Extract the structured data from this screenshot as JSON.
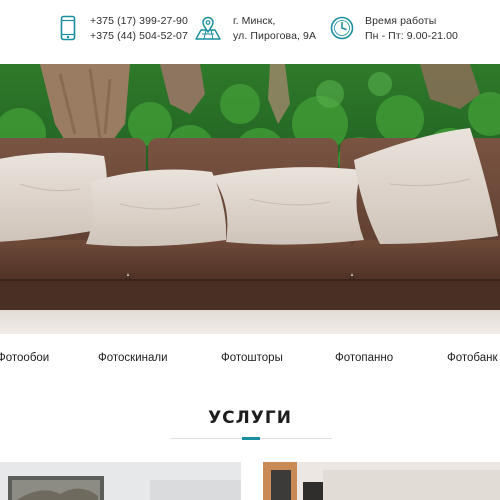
{
  "contacts": {
    "phone": {
      "icon": "phone-icon",
      "line1": "+375 (17) 399-27-90",
      "line2": "+375 (44) 504-52-07"
    },
    "address": {
      "icon": "map-pin-icon",
      "line1": "г. Минск,",
      "line2": "ул. Пирогова, 9А"
    },
    "hours": {
      "icon": "clock-icon",
      "line1": "Время работы",
      "line2": "Пн - Пт: 9.00-21.00"
    }
  },
  "nav": {
    "items": [
      "Фотообои",
      "Фотоскинали",
      "Фотошторы",
      "Фотопанно",
      "Фотобанк"
    ]
  },
  "services": {
    "title": "УСЛУГИ"
  },
  "colors": {
    "accent": "#1a8fa0",
    "sofa": "#6e4b3a",
    "text": "#2a2a2a"
  }
}
